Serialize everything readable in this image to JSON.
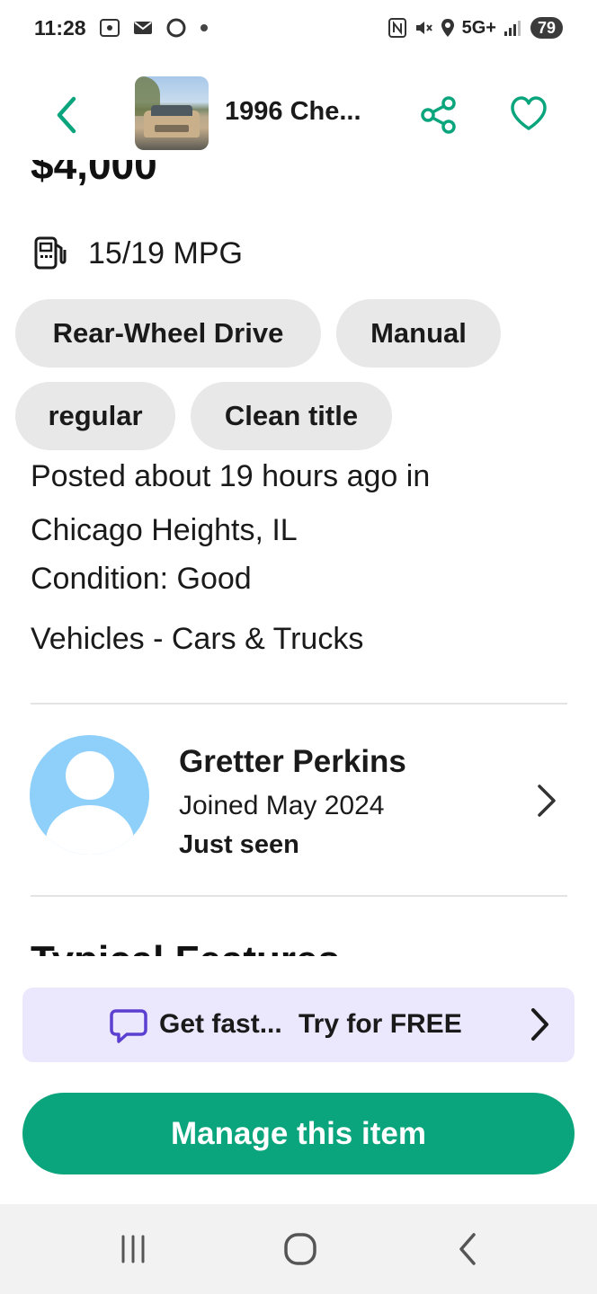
{
  "status_bar": {
    "time": "11:28",
    "network": "5G+",
    "battery": "79"
  },
  "header": {
    "title": "1996 Che...",
    "back_icon": "chevron-left-icon",
    "share_icon": "share-icon",
    "favorite_icon": "heart-icon"
  },
  "listing": {
    "price": "$4,000",
    "mpg": "15/19 MPG",
    "chips": [
      "Rear-Wheel Drive",
      "Manual",
      "regular",
      "Clean title"
    ],
    "posted": "Posted about 19 hours ago in Chicago Heights, IL",
    "condition": "Condition: Good",
    "category": "Vehicles - Cars & Trucks"
  },
  "seller": {
    "name": "Gretter Perkins",
    "joined": "Joined May 2024",
    "last_seen": "Just seen"
  },
  "features": {
    "title": "Typical Features"
  },
  "promo": {
    "text": "Get fast...",
    "cta": "Try for FREE"
  },
  "actions": {
    "manage_label": "Manage this item"
  },
  "colors": {
    "accent": "#0aa57c",
    "promo_bg": "#ebe7fd",
    "promo_icon": "#5b3fd1",
    "chip_bg": "#e8e8e8",
    "avatar_bg": "#8fd0fb"
  }
}
